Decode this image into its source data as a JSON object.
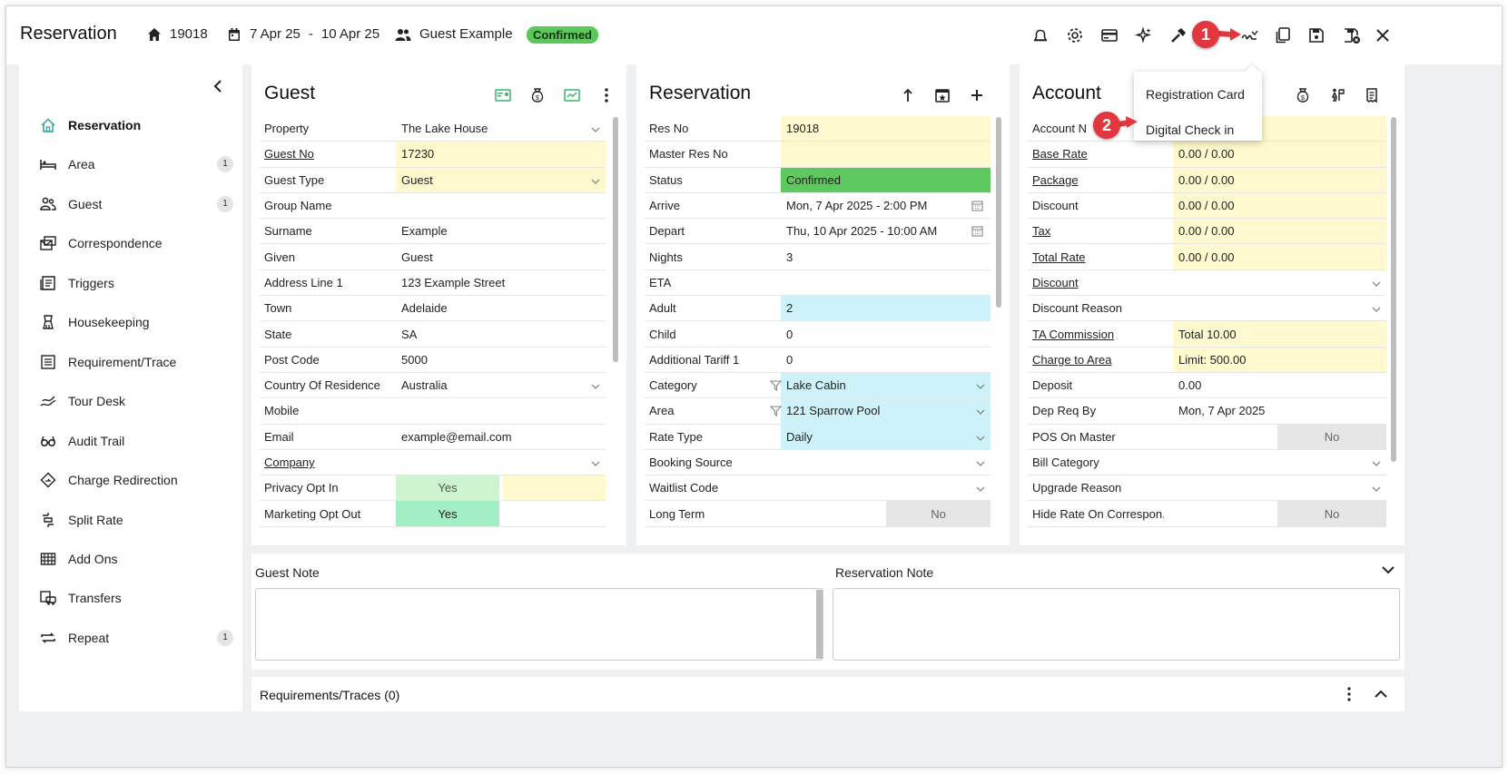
{
  "header": {
    "title": "Reservation",
    "res_no": "19018",
    "date_from": "7 Apr 25",
    "date_sep": "-",
    "date_to": "10 Apr 25",
    "guest_name": "Guest Example",
    "status_badge": "Confirmed",
    "toolbar_icons": [
      "bell-icon",
      "settings-icon",
      "card-icon",
      "sparkle-icon",
      "tools-icon",
      "checkin-icon",
      "copy-icon",
      "save-icon",
      "save-close-icon",
      "close-icon"
    ]
  },
  "sidebar": {
    "items": [
      {
        "label": "Reservation",
        "icon": "home-icon",
        "count": ""
      },
      {
        "label": "Area",
        "icon": "bed-icon",
        "count": "1"
      },
      {
        "label": "Guest",
        "icon": "people-icon",
        "count": "1"
      },
      {
        "label": "Correspondence",
        "icon": "mail-icon",
        "count": ""
      },
      {
        "label": "Triggers",
        "icon": "triggers-icon",
        "count": ""
      },
      {
        "label": "Housekeeping",
        "icon": "housekeeping-icon",
        "count": ""
      },
      {
        "label": "Requirement/Trace",
        "icon": "list-icon",
        "count": ""
      },
      {
        "label": "Tour Desk",
        "icon": "tour-icon",
        "count": ""
      },
      {
        "label": "Audit Trail",
        "icon": "glasses-icon",
        "count": ""
      },
      {
        "label": "Charge Redirection",
        "icon": "redirect-icon",
        "count": ""
      },
      {
        "label": "Split Rate",
        "icon": "split-icon",
        "count": ""
      },
      {
        "label": "Add Ons",
        "icon": "addons-icon",
        "count": ""
      },
      {
        "label": "Transfers",
        "icon": "transfers-icon",
        "count": ""
      },
      {
        "label": "Repeat",
        "icon": "repeat-icon",
        "count": "1"
      }
    ]
  },
  "guest": {
    "title": "Guest",
    "rows": [
      {
        "label": "Property",
        "value": "The Lake House"
      },
      {
        "label": "Guest No",
        "value": "17230"
      },
      {
        "label": "Guest Type",
        "value": "Guest"
      },
      {
        "label": "Group Name",
        "value": ""
      },
      {
        "label": "Surname",
        "value": "Example"
      },
      {
        "label": "Given",
        "value": "Guest"
      },
      {
        "label": "Address Line 1",
        "value": "123 Example Street"
      },
      {
        "label": "Town",
        "value": "Adelaide"
      },
      {
        "label": "State",
        "value": "SA"
      },
      {
        "label": "Post Code",
        "value": "5000"
      },
      {
        "label": "Country Of Residence",
        "value": "Australia"
      },
      {
        "label": "Mobile",
        "value": ""
      },
      {
        "label": "Email",
        "value": "example@email.com"
      },
      {
        "label": "Company",
        "value": ""
      },
      {
        "label": "Privacy Opt In",
        "value": "Yes"
      },
      {
        "label": "Marketing Opt Out",
        "value": "Yes"
      }
    ]
  },
  "reservation": {
    "title": "Reservation",
    "rows": [
      {
        "label": "Res No",
        "value": "19018"
      },
      {
        "label": "Master Res No",
        "value": ""
      },
      {
        "label": "Status",
        "value": "Confirmed"
      },
      {
        "label": "Arrive",
        "value": "Mon, 7 Apr 2025 - 2:00 PM"
      },
      {
        "label": "Depart",
        "value": "Thu, 10 Apr 2025 - 10:00 AM"
      },
      {
        "label": "Nights",
        "value": "3"
      },
      {
        "label": "ETA",
        "value": ""
      },
      {
        "label": "Adult",
        "value": "2"
      },
      {
        "label": "Child",
        "value": "0"
      },
      {
        "label": "Additional Tariff 1",
        "value": "0"
      },
      {
        "label": "Category",
        "value": "Lake Cabin"
      },
      {
        "label": "Area",
        "value": "121 Sparrow Pool"
      },
      {
        "label": "Rate Type",
        "value": "Daily"
      },
      {
        "label": "Booking Source",
        "value": ""
      },
      {
        "label": "Waitlist Code",
        "value": ""
      },
      {
        "label": "Long Term",
        "value": "No"
      }
    ]
  },
  "account": {
    "title": "Account",
    "rows": [
      {
        "label": "Account N",
        "value": ""
      },
      {
        "label": "Base Rate",
        "value": "0.00 / 0.00"
      },
      {
        "label": "Package",
        "value": "0.00 / 0.00"
      },
      {
        "label": "Discount",
        "value": "0.00 / 0.00"
      },
      {
        "label": "Tax",
        "value": "0.00 / 0.00"
      },
      {
        "label": "Total Rate",
        "value": "0.00 / 0.00"
      },
      {
        "label": "Discount",
        "value": ""
      },
      {
        "label": "Discount Reason",
        "value": ""
      },
      {
        "label": "TA Commission",
        "value": "Total 10.00"
      },
      {
        "label": "Charge to Area",
        "value": "Limit: 500.00"
      },
      {
        "label": "Deposit",
        "value": "0.00"
      },
      {
        "label": "Dep Req By",
        "value": "Mon, 7 Apr 2025"
      },
      {
        "label": "POS On Master",
        "value": "No"
      },
      {
        "label": "Bill Category",
        "value": ""
      },
      {
        "label": "Upgrade Reason",
        "value": ""
      },
      {
        "label": "Hide Rate On Correspon...",
        "value": "No"
      }
    ]
  },
  "dropdown": {
    "items": [
      "Registration Card",
      "Digital Check in"
    ]
  },
  "callouts": {
    "step1": "1",
    "step2": "2"
  },
  "notes": {
    "guest_note_label": "Guest Note",
    "reservation_note_label": "Reservation Note"
  },
  "requirements": {
    "label": "Requirements/Traces (0)"
  },
  "colors": {
    "accent": "#2aa198",
    "confirmed": "#5cc85c",
    "highlight_yellow": "#fff9cf",
    "highlight_blue": "#cdf2f9",
    "callout_red": "#e3373f"
  }
}
